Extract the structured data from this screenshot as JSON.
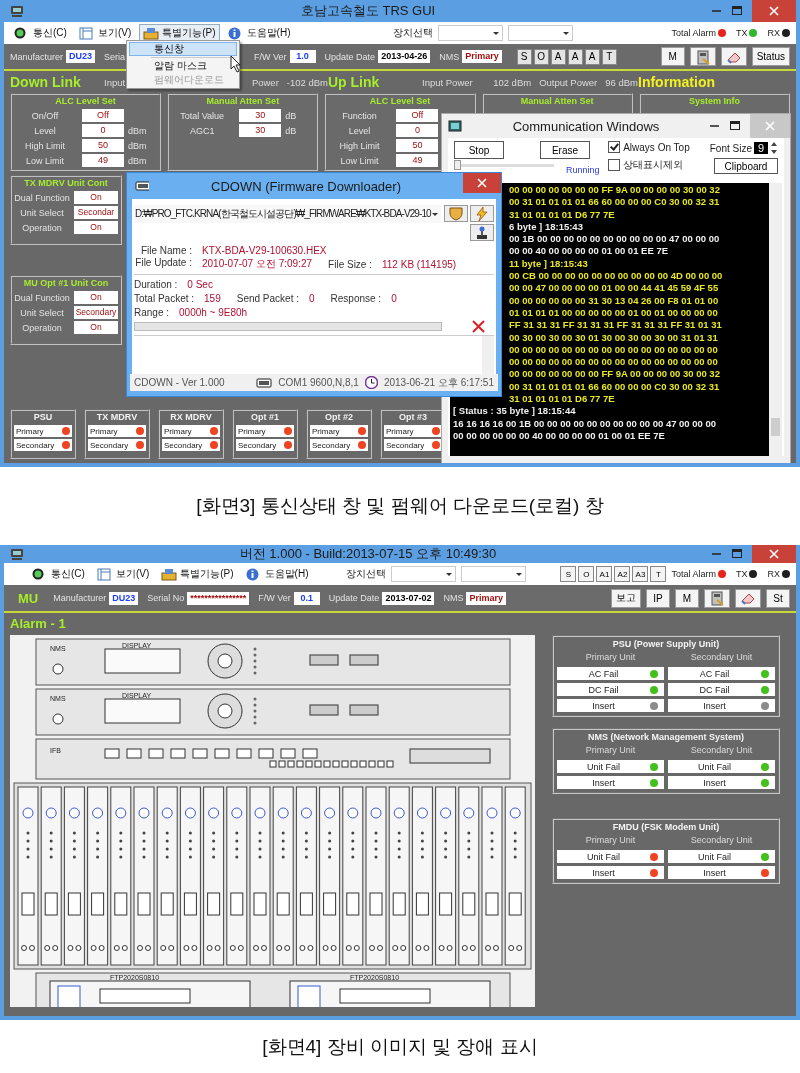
{
  "screen_3": {
    "window": {
      "title": "호남고속철도 TRS GUI"
    },
    "menus": [
      {
        "label": "통신(C)",
        "selected": false
      },
      {
        "label": "보기(V)",
        "selected": false
      },
      {
        "label": "특별기능(P)",
        "selected": true
      },
      {
        "label": "도움말(H)",
        "selected": false
      }
    ],
    "device_select": {
      "label": "장치선택"
    },
    "indicators": [
      {
        "label": "Total Alarm",
        "color": "#e8221c"
      },
      {
        "label": "TX",
        "color": "#2eb82e"
      },
      {
        "label": "RX",
        "color": "#1e1e1e"
      }
    ],
    "popup_menu": [
      {
        "label": "통신창",
        "selected": true,
        "disabled": false
      },
      {
        "label": "알람 마스크",
        "selected": false,
        "disabled": false
      },
      {
        "label": "펌웨어다운로드",
        "selected": false,
        "disabled": true
      }
    ],
    "info_fields": [
      {
        "label": "Manufacturer",
        "value": "DU23",
        "color": "#1a3cff"
      },
      {
        "label": "Seria"
      },
      {
        "label": "F/W Ver",
        "value": "1.0",
        "color": "#1a3cff"
      },
      {
        "label": "Update Date",
        "value": "2013-04-26",
        "color": "#000000"
      },
      {
        "label": "NMS",
        "value": "Primary",
        "color": "#a01010"
      }
    ],
    "mode_buttons": [
      "S",
      "O",
      "A",
      "A",
      "A",
      "T"
    ],
    "tool_buttons": [
      {
        "kind": "text",
        "label": "M"
      },
      {
        "kind": "device"
      },
      {
        "kind": "eraser"
      },
      {
        "kind": "text",
        "label": "Status"
      }
    ],
    "sections": [
      {
        "title": "Down Link",
        "color": "#a6ee2a",
        "readings": [
          "Input",
          "Power",
          "-102 dBm"
        ]
      },
      {
        "title": "Up Link",
        "color": "#a6ee2a",
        "readings": [
          "Input Power",
          "102 dBm",
          "Output Power",
          "96 dBm"
        ]
      },
      {
        "title": "Information",
        "color": "#f2f21e"
      }
    ],
    "panels": [
      {
        "title": "ALC Level Set",
        "rows": [
          {
            "label": "On/Off",
            "value": "Off"
          },
          {
            "label": "Level",
            "value": "0",
            "unit": "dBm"
          },
          {
            "label": "High Limit",
            "value": "50",
            "unit": "dBm"
          },
          {
            "label": "Low Limit",
            "value": "49",
            "unit": "dBm"
          }
        ]
      },
      {
        "title": "Manual Atten Set",
        "rows": [
          {
            "label": "Total Value",
            "value": "30",
            "unit": "dB"
          },
          {
            "label": "AGC1",
            "value": "30",
            "unit": "dB"
          }
        ]
      },
      {
        "title": "ALC Level Set",
        "rows": [
          {
            "label": "Function",
            "value": "Off"
          },
          {
            "label": "Level",
            "value": "0"
          },
          {
            "label": "High Limit",
            "value": "50"
          },
          {
            "label": "Low Limit",
            "value": "49"
          }
        ]
      },
      {
        "title": "Manual Atten Set"
      },
      {
        "title": "System Info"
      }
    ],
    "unit_panels": [
      {
        "title": "TX MDRV Unit Cont",
        "rows": [
          {
            "label": "Dual Function",
            "value": "On"
          },
          {
            "label": "Unit Select",
            "value": "Secondar"
          },
          {
            "label": "Operation",
            "value": "On"
          }
        ]
      },
      {
        "title": "MU Opt #1 Unit Con",
        "rows": [
          {
            "label": "Dual Function",
            "value": "On"
          },
          {
            "label": "Unit Select",
            "value": "Secondary"
          },
          {
            "label": "Operation",
            "value": "On"
          }
        ]
      }
    ],
    "status_groups": [
      {
        "title": "PSU",
        "rows": [
          {
            "label": "Primary",
            "color": "#ee4422"
          },
          {
            "label": "Secondary",
            "color": "#ee4422"
          }
        ]
      },
      {
        "title": "TX MDRV",
        "rows": [
          {
            "label": "Primary",
            "color": "#ee4422"
          },
          {
            "label": "Secondary",
            "color": "#ee4422"
          }
        ]
      },
      {
        "title": "RX MDRV",
        "rows": [
          {
            "label": "Primary",
            "color": "#ee4422"
          },
          {
            "label": "Secondary",
            "color": "#ee4422"
          }
        ]
      },
      {
        "title": "Opt #1",
        "rows": [
          {
            "label": "Primary",
            "color": "#ee4422"
          },
          {
            "label": "Secondary",
            "color": "#ee4422"
          }
        ]
      },
      {
        "title": "Opt #2",
        "rows": [
          {
            "label": "Primary",
            "color": "#ee4422"
          },
          {
            "label": "Secondary",
            "color": "#ee4422"
          }
        ]
      },
      {
        "title": "Opt #3",
        "rows": [
          {
            "label": "Primary",
            "color": "#ee4422"
          },
          {
            "label": "Secondary",
            "color": "#ee4422"
          }
        ]
      }
    ],
    "downloader": {
      "title": "CDOWN (Firmware Downloader)",
      "path": "D:₩PRO_FTC.KRNA(한국철도시설공단)₩_FIRMWARE₩KTX-BDA-V29-10",
      "file_lines": [
        [
          {
            "label": "File Name :",
            "value": "KTX-BDA-V29-100630.HEX"
          }
        ],
        [
          {
            "label": "File Update :",
            "value": "2010-07-07 오전 7:09:27"
          },
          {
            "label": "File Size :",
            "value": "112 KB (114195)"
          }
        ]
      ],
      "stat_lines": [
        [
          {
            "label": "Duration :",
            "value": "0  Sec"
          }
        ],
        [
          {
            "label": "Total Packet :",
            "value": "159"
          },
          {
            "label": "Send Packet :",
            "value": "0"
          },
          {
            "label": "Response :",
            "value": "0"
          }
        ],
        [
          {
            "label": "Range :",
            "value": "0000h ~ 9E80h"
          }
        ]
      ],
      "progress": {
        "level": 0
      },
      "status_bar": {
        "version": "CDOWN  -  Ver 1.000",
        "port": "COM1 9600,N,8,1",
        "time": "2013-06-21 오후 6:17:51"
      }
    },
    "comm_window": {
      "title": "Communication Windows",
      "buttons": [
        "Stop",
        "Erase"
      ],
      "slider": {
        "level": 0
      },
      "run_state": "Running",
      "checkboxes": [
        {
          "label": "Always On Top",
          "checked": true
        },
        {
          "label": "상태표시제외",
          "checked": false
        }
      ],
      "font_size": {
        "label": "Font Size",
        "value": "9"
      },
      "clipboard_button": "Clipboard",
      "log_lines_partly_hidden": [
        {
          "text": "00 00 00 00 00 00 00 FF 9A 00 00 00 00 30 00 32",
          "color": "#e8e820"
        },
        {
          "text": "00 31 01 01 01 01 66 60 00 00 00 C0 30 00 32 31",
          "color": "#e8e820"
        },
        {
          "text": "31 01 01 01 01 D6 77 7E",
          "color": "#e8e820"
        },
        {
          "text": "6 byte ] 18:15:43",
          "color": "#f0f0f0"
        },
        {
          "text": "00 1B 00 00 00 00 00 00 00 00 00 00 47 00 00 00",
          "color": "#f0f0f0"
        },
        {
          "text": "00 00 40 00 00 00 00 01 00 01 EE 7E",
          "color": "#f0f0f0"
        },
        {
          "text": "11 byte ] 18:15:43",
          "color": "#e8e820"
        },
        {
          "text": "00 CB 00 00 00 00 00 00 00 00 00 00 4D 00 00 00",
          "color": "#e8e820"
        },
        {
          "text": "00 00 47 00 00 00 00 01 00 00 44 41 45 59 4F 55",
          "color": "#e8e820"
        },
        {
          "text": "00 00 00 00 00 00 31 30 13 04 26 00 F8 01 01 00",
          "color": "#e8e820"
        },
        {
          "text": "01 01 01 01 00 00 00 00 00 01 00 01 00 00 00 00",
          "color": "#e8e820"
        },
        {
          "text": "FF 31 31 31 FF 31 31 31 FF 31 31 31 FF 31 01 31",
          "color": "#e8e820"
        },
        {
          "text": "00 30 00 30 00 30 01 30 00 30 00 30 00 31 01 31",
          "color": "#e8e820"
        },
        {
          "text": "00 00 00 00 00 00 00 00 00 00 00 00 00 00 00 00",
          "color": "#e8e820"
        },
        {
          "text": "00 00 00 00 00 00 00 00 00 00 00 00 00 00 00 00",
          "color": "#e8e820"
        },
        {
          "text": "00 00 00 00 00 00 00 FF 9A 00 00 00 00 30 00 32",
          "color": "#e8e820"
        },
        {
          "text": "00 31 01 01 01 01 66 60 00 00 00 C0 30 00 32 31",
          "color": "#e8e820"
        },
        {
          "text": "31 01 01 01 01 D6 77 7E",
          "color": "#e8e820"
        }
      ],
      "log_lines": [
        {
          "text": "[ Status : 35 byte ] 18:15:44",
          "color": "#f0f0f0"
        },
        {
          "text": "16 16 16 16 00 1B 00 00 00 00 00 00 00 00 00 00 47 00 00 00",
          "color": "#f0f0f0"
        },
        {
          "text": "00 00 00 00 00 00 40 00 00 00 00 01 00 01 EE 7E",
          "color": "#f0f0f0"
        }
      ]
    },
    "caption": "[화면3] 통신상태 창 및 펌웨어 다운로드(로컬) 창"
  },
  "screen_4": {
    "window": {
      "title": "버전 1.000 - Build:2013-07-15 오후 10:49:30"
    },
    "menus": [
      {
        "label": "통신(C)",
        "selected": false
      },
      {
        "label": "보기(V)",
        "selected": false
      },
      {
        "label": "특별기능(P)",
        "selected": false
      },
      {
        "label": "도움말(H)",
        "selected": false
      }
    ],
    "device_select": {
      "label": "장치선택"
    },
    "mode_buttons": [
      "S",
      "O",
      "A1",
      "A2",
      "A3",
      "T"
    ],
    "indicators": [
      {
        "label": "Total Alarm",
        "color": "#e8221c"
      },
      {
        "label": "TX",
        "color": "#1e1e1e"
      },
      {
        "label": "RX",
        "color": "#1e1e1e"
      }
    ],
    "unit_label": "MU",
    "info_fields": [
      {
        "label": "Manufacturer",
        "value": "DU23",
        "color": "#1a3cff"
      },
      {
        "label": "Serial No",
        "value": "****************",
        "color": "#a01010"
      },
      {
        "label": "F/W Ver",
        "value": "0.1",
        "color": "#1a3cff"
      },
      {
        "label": "Update Date",
        "value": "2013-07-02",
        "color": "#000000"
      },
      {
        "label": "NMS",
        "value": "Primary",
        "color": "#a01010"
      }
    ],
    "tool_buttons": [
      {
        "kind": "text",
        "label": "보고"
      },
      {
        "kind": "text",
        "label": "IP"
      },
      {
        "kind": "text",
        "label": "M"
      },
      {
        "kind": "device"
      },
      {
        "kind": "eraser"
      },
      {
        "kind": "text",
        "label": "St"
      }
    ],
    "alarm_title": "Alarm - 1",
    "rack": {
      "shelves": [
        {
          "kind": "nms",
          "label": "NMS",
          "display": "DISPLAY"
        },
        {
          "kind": "nms",
          "label": "NMS",
          "display": "DISPLAY"
        },
        {
          "kind": "ifb",
          "label": "IFB"
        },
        {
          "kind": "cards"
        },
        {
          "kind": "ftp",
          "labels": [
            "FTP2020S0810",
            "FTP2020S0810"
          ]
        }
      ]
    },
    "alarm_panels": [
      {
        "title": "PSU (Power Supply Unit)",
        "units": [
          {
            "heading": "Primary Unit",
            "items": [
              {
                "label": "AC Fail",
                "color": "#44c01c"
              },
              {
                "label": "DC Fail",
                "color": "#44c01c"
              },
              {
                "label": "Insert",
                "color": "#8c8c8c"
              }
            ]
          },
          {
            "heading": "Secondary Unit",
            "items": [
              {
                "label": "AC Fail",
                "color": "#44c01c"
              },
              {
                "label": "DC Fail",
                "color": "#44c01c"
              },
              {
                "label": "Insert",
                "color": "#8c8c8c"
              }
            ]
          }
        ]
      },
      {
        "title": "NMS (Network Management System)",
        "units": [
          {
            "heading": "Primary Unit",
            "items": [
              {
                "label": "Unit Fail",
                "color": "#44c01c"
              },
              {
                "label": "Insert",
                "color": "#44c01c"
              }
            ]
          },
          {
            "heading": "Secondary Unit",
            "items": [
              {
                "label": "Unit Fail",
                "color": "#44c01c"
              },
              {
                "label": "Insert",
                "color": "#44c01c"
              }
            ]
          }
        ]
      },
      {
        "title": "FMDU (FSK Modem Unit)",
        "units": [
          {
            "heading": "Primary Unit",
            "items": [
              {
                "label": "Unit Fail",
                "color": "#ee4422"
              },
              {
                "label": "Insert",
                "color": "#ee4422"
              }
            ]
          },
          {
            "heading": "Secondary Unit",
            "items": [
              {
                "label": "Unit Fail",
                "color": "#44c01c"
              },
              {
                "label": "Insert",
                "color": "#ee4422"
              }
            ]
          }
        ]
      }
    ],
    "caption": "[화면4] 장비 이미지 및 장애 표시"
  }
}
